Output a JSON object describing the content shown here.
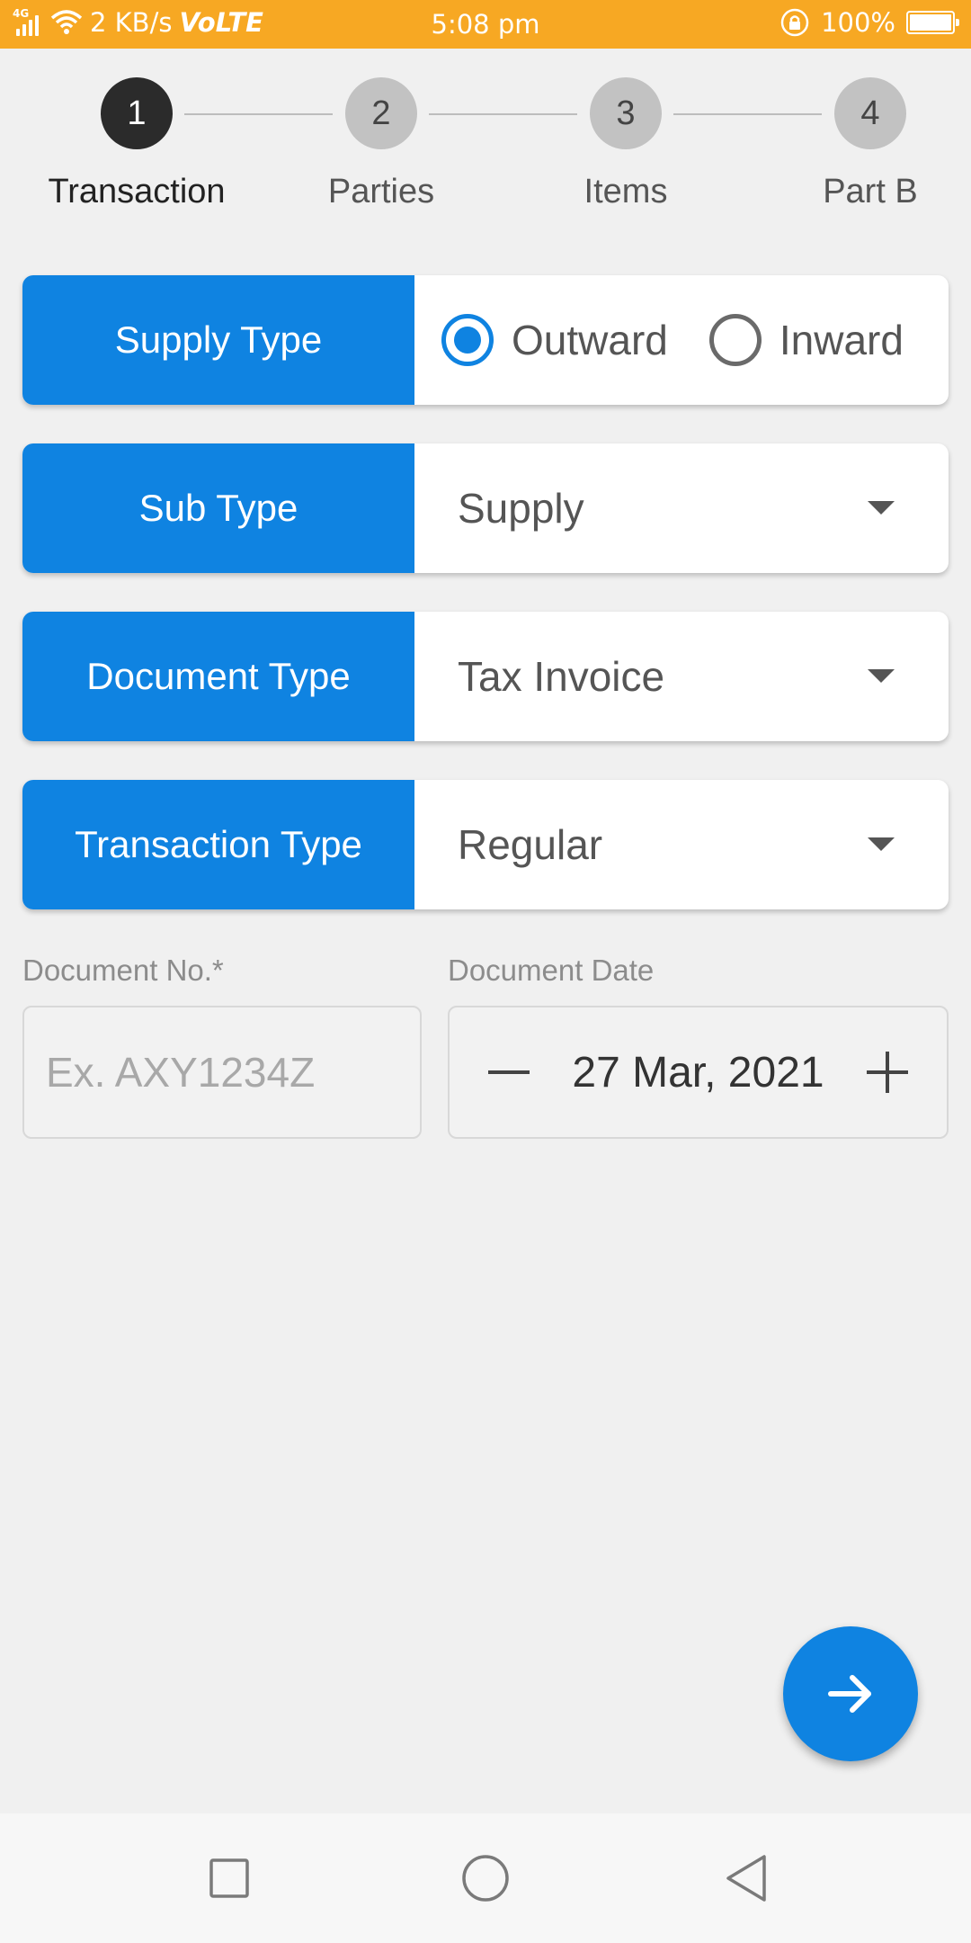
{
  "status_bar": {
    "network_label": "4G",
    "speed": "2 KB/s",
    "volte": "VoLTE",
    "time": "5:08 pm",
    "battery_percent": "100%",
    "battery_level": 1.0
  },
  "stepper": {
    "steps": [
      {
        "number": "1",
        "label": "Transaction",
        "active": true
      },
      {
        "number": "2",
        "label": "Parties",
        "active": false
      },
      {
        "number": "3",
        "label": "Items",
        "active": false
      },
      {
        "number": "4",
        "label": "Part B",
        "active": false
      }
    ]
  },
  "form": {
    "supply_type": {
      "label": "Supply Type",
      "options": [
        {
          "label": "Outward",
          "selected": true
        },
        {
          "label": "Inward",
          "selected": false
        }
      ]
    },
    "sub_type": {
      "label": "Sub Type",
      "value": "Supply"
    },
    "document_type": {
      "label": "Document Type",
      "value": "Tax Invoice"
    },
    "transaction_type": {
      "label": "Transaction Type",
      "value": "Regular"
    },
    "document_no": {
      "label": "Document No.*",
      "value": "",
      "placeholder": "Ex. AXY1234Z"
    },
    "document_date": {
      "label": "Document Date",
      "value": "27 Mar, 2021"
    }
  },
  "colors": {
    "status_bar": "#f7a823",
    "accent": "#0f83e1",
    "active_step": "#2b2b2b",
    "inactive_step": "#c2c2c2"
  },
  "icons": {
    "fab": "arrow-right-icon",
    "nav_recent": "square-icon",
    "nav_home": "circle-icon",
    "nav_back": "triangle-back-icon"
  }
}
